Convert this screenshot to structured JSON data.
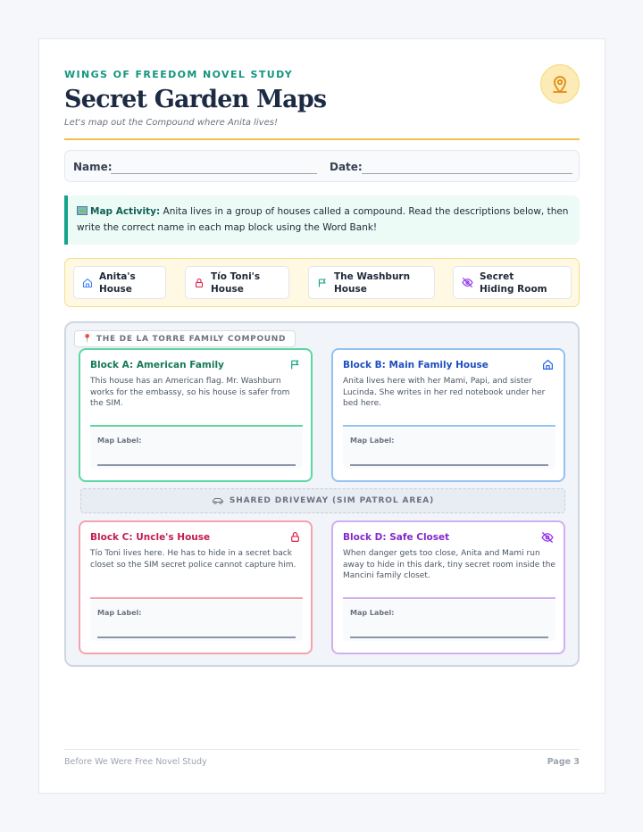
{
  "header": {
    "series": "WINGS OF FREEDOM NOVEL STUDY",
    "title": "Secret Garden Maps",
    "subtitle": "Let's map out the Compound where Anita lives!"
  },
  "name_row": {
    "name_label": "Name:",
    "date_label": "Date:"
  },
  "activity": {
    "lead": "Map Activity:",
    "text": " Anita lives in a group of houses called a compound. Read the descriptions below, then write the correct name in each map block using the Word Bank!"
  },
  "word_bank": [
    {
      "label": "Anita's House",
      "icon": "home-icon"
    },
    {
      "label": "Tío Toni's House",
      "icon": "lock-icon"
    },
    {
      "label": "The Washburn House",
      "icon": "flag-icon"
    },
    {
      "label": "Secret Hiding Room",
      "icon": "eye-off-icon"
    }
  ],
  "compound": {
    "tag": "THE DE LA TORRE FAMILY COMPOUND",
    "driveway": "SHARED DRIVEWAY (SIM PATROL AREA)",
    "map_label": "Map Label:",
    "blocks": [
      {
        "title": "Block A: American Family",
        "text": "This house has an American flag. Mr. Washburn works for the embassy, so his house is safer from the SIM.",
        "color": "#5ed6a0",
        "title_color": "#157a55",
        "icon": "flag-icon"
      },
      {
        "title": "Block B: Main Family House",
        "text": "Anita lives here with her Mami, Papi, and sister Lucinda. She writes in her red notebook under her bed here.",
        "color": "#93c3f2",
        "title_color": "#1e4fbf",
        "icon": "home-icon"
      },
      {
        "title": "Block C: Uncle's House",
        "text": "Tío Toni lives here. He has to hide in a secret back closet so the SIM secret police cannot capture him.",
        "color": "#f4a3ad",
        "title_color": "#c21d4f",
        "icon": "lock-icon"
      },
      {
        "title": "Block D: Safe Closet",
        "text": "When danger gets too close, Anita and Mami run away to hide in this dark, tiny secret room inside the Mancini family closet.",
        "color": "#d2aef0",
        "title_color": "#8429c9",
        "icon": "eye-off-icon"
      }
    ]
  },
  "footer": {
    "left": "Before We Were Free Novel Study",
    "right": "Page 3"
  },
  "colors": {
    "accent_green": "#13957f",
    "gold": "#f2c14d",
    "navy": "#1c2a44"
  }
}
